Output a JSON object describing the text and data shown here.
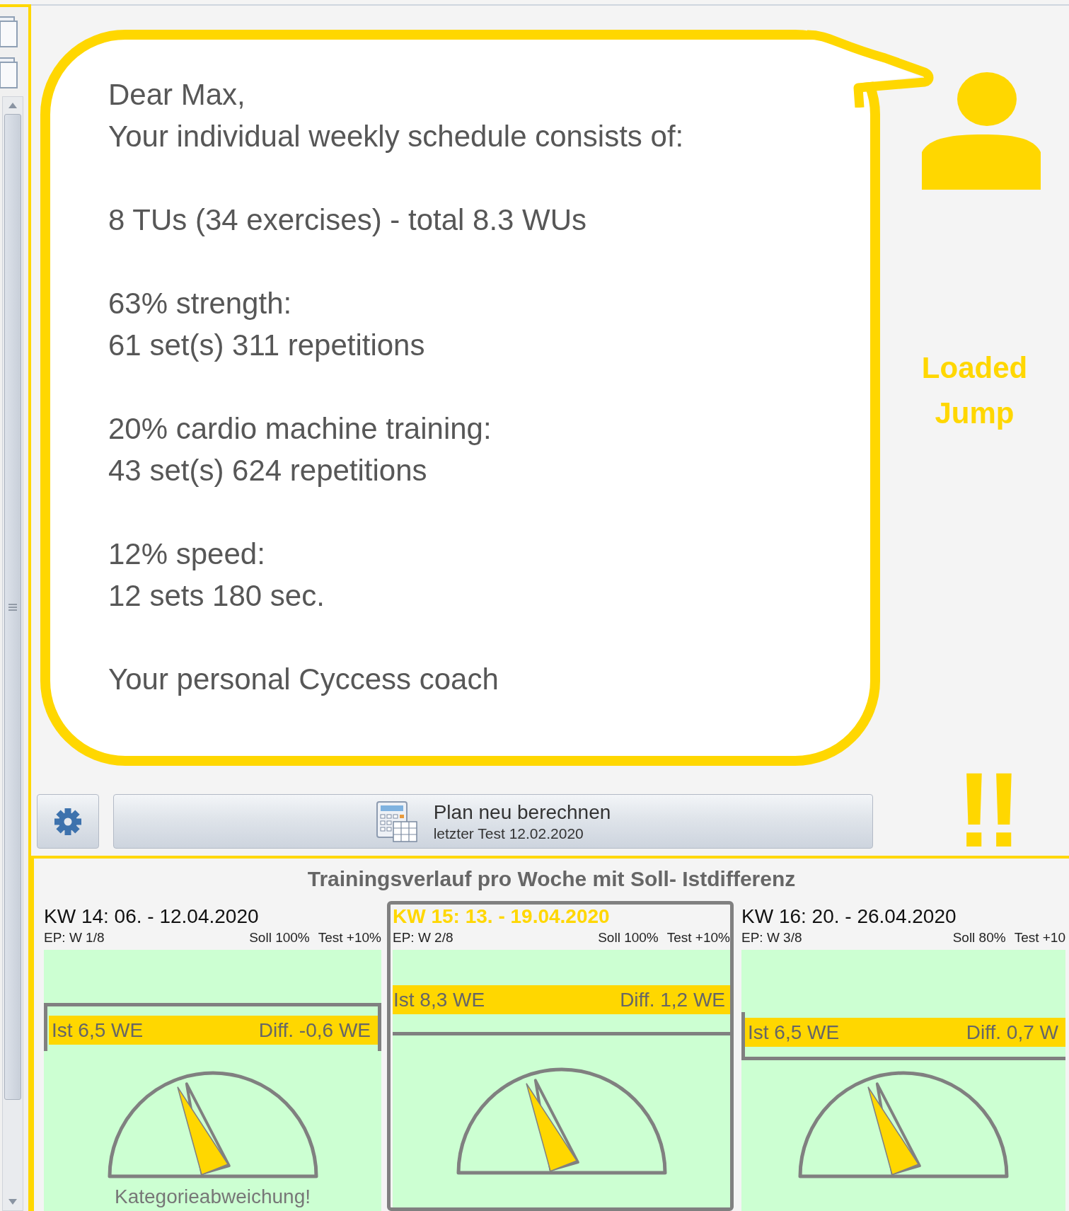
{
  "message": {
    "paragraphs": [
      [
        "Dear Max,",
        "Your individual weekly schedule consists of:"
      ],
      [
        "8 TUs (34 exercises) - total 8.3 WUs"
      ],
      [
        "63% strength:",
        "61 set(s) 311 repetitions"
      ],
      [
        "20% cardio machine training:",
        "43 set(s) 624 repetitions"
      ],
      [
        "12% speed:",
        "12 sets 180 sec."
      ],
      [
        "Your personal Cyccess coach"
      ]
    ]
  },
  "coach": {
    "label": "Loaded Jump"
  },
  "alert_marks": "!!",
  "recalculate_button": {
    "label": "Plan neu berechnen",
    "sublabel": "letzter Test 12.02.2020"
  },
  "panel": {
    "title": "Trainingsverlauf pro Woche mit Soll- Istdifferenz",
    "weeks": [
      {
        "title": "KW 14: 06. - 12.04.2020",
        "plan_position": "EP: W 1/8",
        "target": "Soll 100%",
        "test": "Test +10%",
        "actual": "Ist 6,5 WE",
        "difference": "Diff. -0,6 WE",
        "warning": "Kategorieabweichung!",
        "selected": false
      },
      {
        "title": "KW 15: 13. - 19.04.2020",
        "plan_position": "EP: W 2/8",
        "target": "Soll 100%",
        "test": "Test +10%",
        "actual": "Ist 8,3 WE",
        "difference": "Diff. 1,2 WE",
        "selected": true
      },
      {
        "title": "KW 16: 20. - 26.04.2020",
        "plan_position": "EP: W 3/8",
        "target": "Soll 80%",
        "test": "Test +10",
        "actual": "Ist 6,5 WE",
        "difference": "Diff. 0,7 W",
        "selected": false
      }
    ]
  }
}
